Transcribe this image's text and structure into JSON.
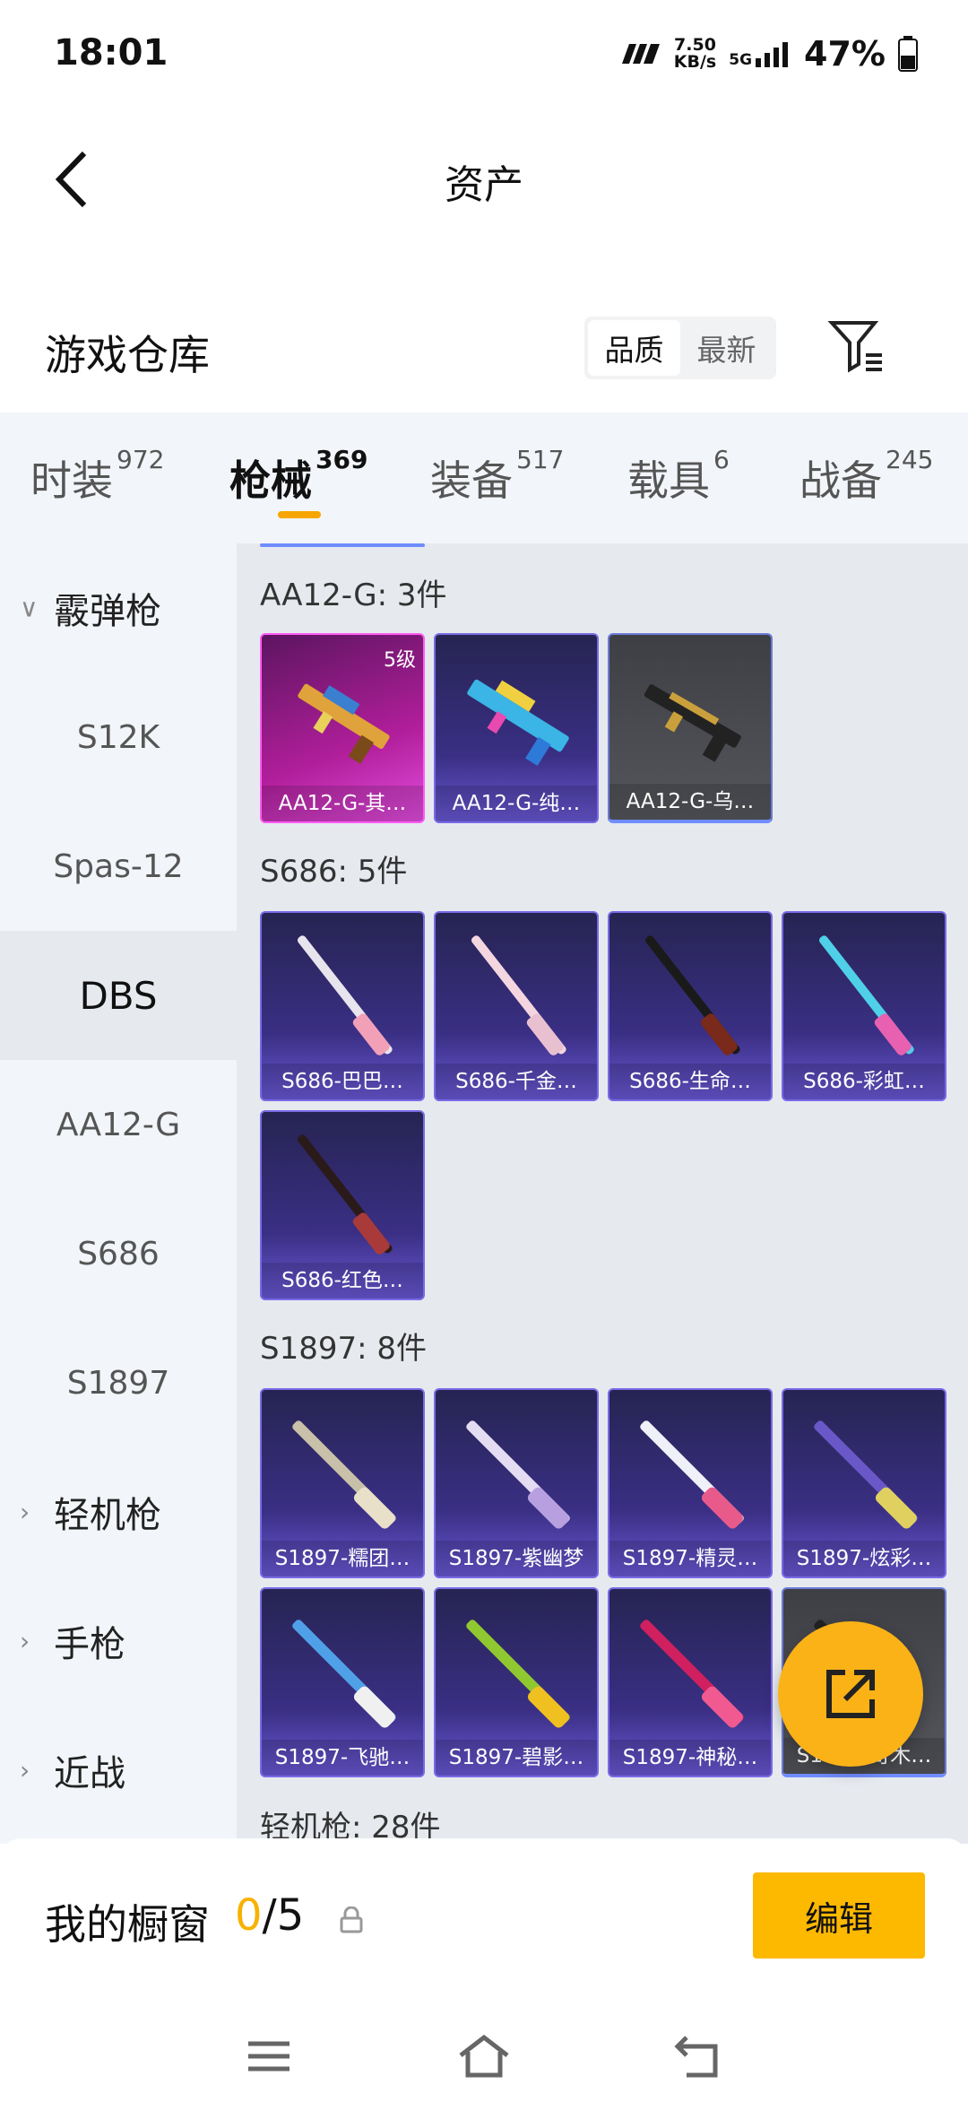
{
  "status": {
    "time": "18:01",
    "speed_value": "7.50",
    "speed_unit": "KB/s",
    "network": "5G",
    "battery": "47%"
  },
  "header": {
    "title": "资产"
  },
  "warehouse": {
    "title": "游戏仓库",
    "sort_options": [
      "品质",
      "最新"
    ],
    "active_sort": "品质"
  },
  "tabs": [
    {
      "label": "时装",
      "count": "972"
    },
    {
      "label": "枪械",
      "count": "369"
    },
    {
      "label": "装备",
      "count": "517"
    },
    {
      "label": "载具",
      "count": "6"
    },
    {
      "label": "战备",
      "count": "245"
    }
  ],
  "active_tab": "枪械",
  "sidebar": {
    "items": [
      {
        "label": "霰弹枪",
        "type": "group",
        "expanded": true
      },
      {
        "label": "S12K",
        "type": "sub"
      },
      {
        "label": "Spas-12",
        "type": "sub"
      },
      {
        "label": "DBS",
        "type": "sub",
        "active": true
      },
      {
        "label": "AA12-G",
        "type": "sub"
      },
      {
        "label": "S686",
        "type": "sub"
      },
      {
        "label": "S1897",
        "type": "sub"
      },
      {
        "label": "轻机枪",
        "type": "group"
      },
      {
        "label": "手枪",
        "type": "group"
      },
      {
        "label": "近战",
        "type": "group"
      }
    ]
  },
  "groups": [
    {
      "title": "AA12-G: 3件",
      "items": [
        {
          "name": "AA12-G-其…",
          "level": "5级",
          "style": "pink"
        },
        {
          "name": "AA12-G-纯…",
          "style": "purple"
        },
        {
          "name": "AA12-G-乌…",
          "style": "grey"
        }
      ]
    },
    {
      "title": "S686: 5件",
      "items": [
        {
          "name": "S686-巴巴…",
          "style": "purple"
        },
        {
          "name": "S686-千金…",
          "style": "purple"
        },
        {
          "name": "S686-生命…",
          "style": "purple"
        },
        {
          "name": "S686-彩虹…",
          "style": "purple"
        },
        {
          "name": "S686-红色…",
          "style": "purple"
        }
      ]
    },
    {
      "title": "S1897: 8件",
      "items": [
        {
          "name": "S1897-糯团…",
          "style": "purple"
        },
        {
          "name": "S1897-紫幽梦",
          "style": "purple"
        },
        {
          "name": "S1897-精灵…",
          "style": "purple"
        },
        {
          "name": "S1897-炫彩…",
          "style": "purple"
        },
        {
          "name": "S1897-飞驰…",
          "style": "purple"
        },
        {
          "name": "S1897-碧影…",
          "style": "purple"
        },
        {
          "name": "S1897-神秘…",
          "style": "purple"
        },
        {
          "name": "S1897-奇木…",
          "style": "grey"
        }
      ]
    },
    {
      "title": "轻机枪: 28件",
      "items": []
    }
  ],
  "showcase": {
    "title": "我的橱窗",
    "current": "0",
    "total": "/5",
    "edit_label": "编辑"
  },
  "colors": {
    "accent": "#f7a500",
    "edit_button": "#fdb800",
    "fab": "#fbb216"
  }
}
